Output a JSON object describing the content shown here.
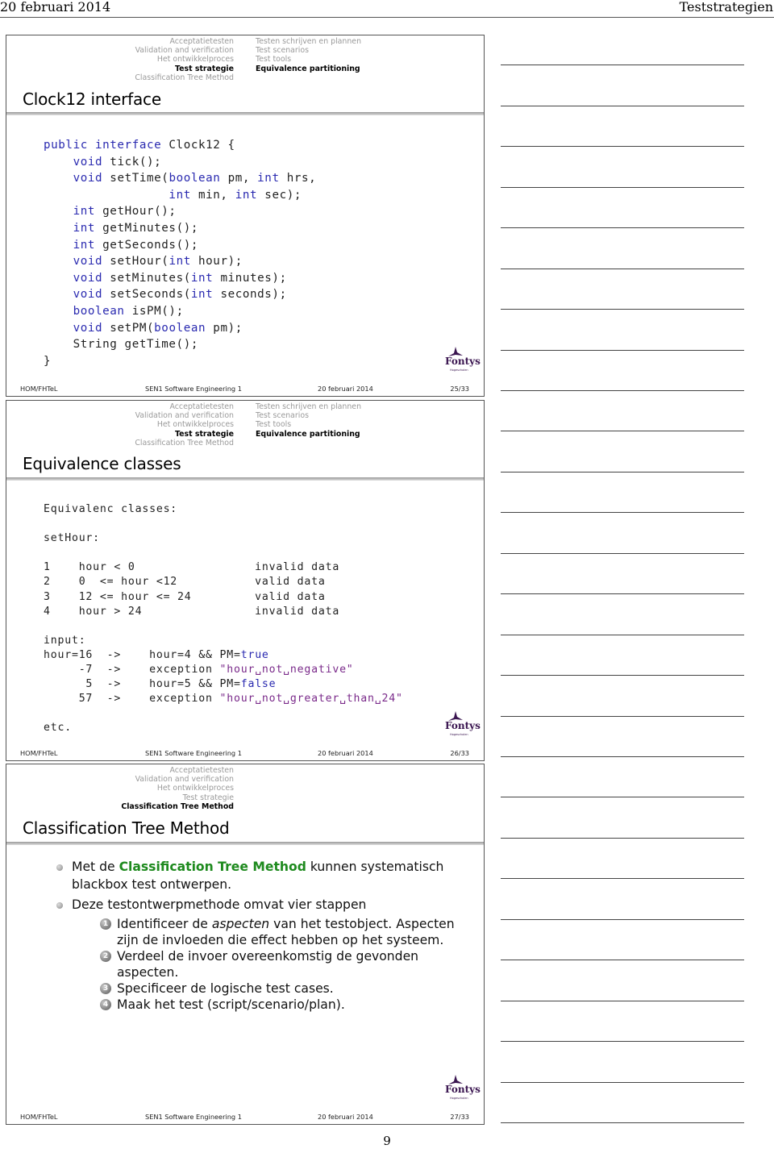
{
  "page_header": {
    "date": "20 februari 2014",
    "title": "Teststrategien"
  },
  "page_number": "9",
  "slides": [
    {
      "nav_sections": [
        "Acceptatietesten",
        "Validation and verification",
        "Het ontwikkelproces",
        "Test strategie",
        "Classification Tree Method"
      ],
      "nav_active_section": "Test strategie",
      "nav_subsections": [
        "Testen schrijven en plannen",
        "Test scenarios",
        "Test tools",
        "Equivalence partitioning"
      ],
      "nav_active_subsection": "Equivalence partitioning",
      "title": "Clock12 interface",
      "code_lines": [
        [
          {
            "t": "public interface",
            "c": "kw"
          },
          {
            "t": " Clock12 {"
          }
        ],
        [
          {
            "t": "    "
          },
          {
            "t": "void",
            "c": "kw"
          },
          {
            "t": " tick();"
          }
        ],
        [
          {
            "t": "    "
          },
          {
            "t": "void",
            "c": "kw"
          },
          {
            "t": " setTime("
          },
          {
            "t": "boolean",
            "c": "kw"
          },
          {
            "t": " pm, "
          },
          {
            "t": "int",
            "c": "kw"
          },
          {
            "t": " hrs,"
          }
        ],
        [
          {
            "t": "                 "
          },
          {
            "t": "int",
            "c": "kw"
          },
          {
            "t": " min, "
          },
          {
            "t": "int",
            "c": "kw"
          },
          {
            "t": " sec);"
          }
        ],
        [
          {
            "t": "    "
          },
          {
            "t": "int",
            "c": "kw"
          },
          {
            "t": " getHour();"
          }
        ],
        [
          {
            "t": "    "
          },
          {
            "t": "int",
            "c": "kw"
          },
          {
            "t": " getMinutes();"
          }
        ],
        [
          {
            "t": "    "
          },
          {
            "t": "int",
            "c": "kw"
          },
          {
            "t": " getSeconds();"
          }
        ],
        [
          {
            "t": "    "
          },
          {
            "t": "void",
            "c": "kw"
          },
          {
            "t": " setHour("
          },
          {
            "t": "int",
            "c": "kw"
          },
          {
            "t": " hour);"
          }
        ],
        [
          {
            "t": "    "
          },
          {
            "t": "void",
            "c": "kw"
          },
          {
            "t": " setMinutes("
          },
          {
            "t": "int",
            "c": "kw"
          },
          {
            "t": " minutes);"
          }
        ],
        [
          {
            "t": "    "
          },
          {
            "t": "void",
            "c": "kw"
          },
          {
            "t": " setSeconds("
          },
          {
            "t": "int",
            "c": "kw"
          },
          {
            "t": " seconds);"
          }
        ],
        [
          {
            "t": "    "
          },
          {
            "t": "boolean",
            "c": "kw"
          },
          {
            "t": " isPM();"
          }
        ],
        [
          {
            "t": "    "
          },
          {
            "t": "void",
            "c": "kw"
          },
          {
            "t": " setPM("
          },
          {
            "t": "boolean",
            "c": "kw"
          },
          {
            "t": " pm);"
          }
        ],
        [
          {
            "t": "    String getTime();"
          }
        ],
        [
          {
            "t": "}"
          }
        ]
      ],
      "footer": {
        "author": "HOM/FHTeL",
        "course": "SEN1 Software Engineering 1",
        "date": "20 februari 2014",
        "page": "25/33"
      },
      "logo": {
        "name": "Fontys",
        "sub": "Hogescholen"
      }
    },
    {
      "nav_sections": [
        "Acceptatietesten",
        "Validation and verification",
        "Het ontwikkelproces",
        "Test strategie",
        "Classification Tree Method"
      ],
      "nav_active_section": "Test strategie",
      "nav_subsections": [
        "Testen schrijven en plannen",
        "Test scenarios",
        "Test tools",
        "Equivalence partitioning"
      ],
      "nav_active_subsection": "Equivalence partitioning",
      "title": "Equivalence classes",
      "code_lines": [
        [
          {
            "t": "Equivalenc classes:"
          }
        ],
        [
          {
            "t": ""
          }
        ],
        [
          {
            "t": "setHour:"
          }
        ],
        [
          {
            "t": ""
          }
        ],
        [
          {
            "t": "1    hour < 0                 invalid data"
          }
        ],
        [
          {
            "t": "2    0  <= hour <12           valid data"
          }
        ],
        [
          {
            "t": "3    12 <= hour <= 24         valid data"
          }
        ],
        [
          {
            "t": "4    hour > 24                invalid data"
          }
        ],
        [
          {
            "t": ""
          }
        ],
        [
          {
            "t": "input:"
          }
        ],
        [
          {
            "t": "hour=16  ->    hour=4 && PM="
          },
          {
            "t": "true",
            "c": "kw"
          }
        ],
        [
          {
            "t": "     -7  ->    exception "
          },
          {
            "t": "\"hour␣not␣negative\"",
            "c": "str"
          }
        ],
        [
          {
            "t": "      5  ->    hour=5 && PM="
          },
          {
            "t": "false",
            "c": "kw"
          }
        ],
        [
          {
            "t": "     57  ->    exception "
          },
          {
            "t": "\"hour␣not␣greater␣than␣24\"",
            "c": "str"
          }
        ],
        [
          {
            "t": ""
          }
        ],
        [
          {
            "t": "etc."
          }
        ]
      ],
      "footer": {
        "author": "HOM/FHTeL",
        "course": "SEN1 Software Engineering 1",
        "date": "20 februari 2014",
        "page": "26/33"
      },
      "logo": {
        "name": "Fontys",
        "sub": "Hogescholen"
      }
    },
    {
      "nav_sections": [
        "Acceptatietesten",
        "Validation and verification",
        "Het ontwikkelproces",
        "Test strategie",
        "Classification Tree Method"
      ],
      "nav_active_section": "Classification Tree Method",
      "title": "Classification Tree Method",
      "bullets": [
        {
          "parts": [
            {
              "t": "Met de "
            },
            {
              "t": "Classification Tree Method",
              "c": "green"
            },
            {
              "t": " kunnen systematisch blackbox test ontwerpen."
            }
          ]
        },
        {
          "parts": [
            {
              "t": "Deze testontwerpmethode omvat vier stappen"
            }
          ],
          "steps": [
            [
              {
                "t": "Identificeer de "
              },
              {
                "t": "aspecten",
                "c": "em"
              },
              {
                "t": " van het testobject. Aspecten zijn de invloeden die effect hebben op het systeem."
              }
            ],
            [
              {
                "t": "Verdeel de invoer overeenkomstig de gevonden aspecten."
              }
            ],
            [
              {
                "t": "Specificeer de logische test cases."
              }
            ],
            [
              {
                "t": "Maak het test (script/scenario/plan)."
              }
            ]
          ]
        }
      ],
      "footer": {
        "author": "HOM/FHTeL",
        "course": "SEN1 Software Engineering 1",
        "date": "20 februari 2014",
        "page": "27/33"
      },
      "logo": {
        "name": "Fontys",
        "sub": "Hogescholen"
      }
    }
  ],
  "notes_lines_per_slide": 9
}
